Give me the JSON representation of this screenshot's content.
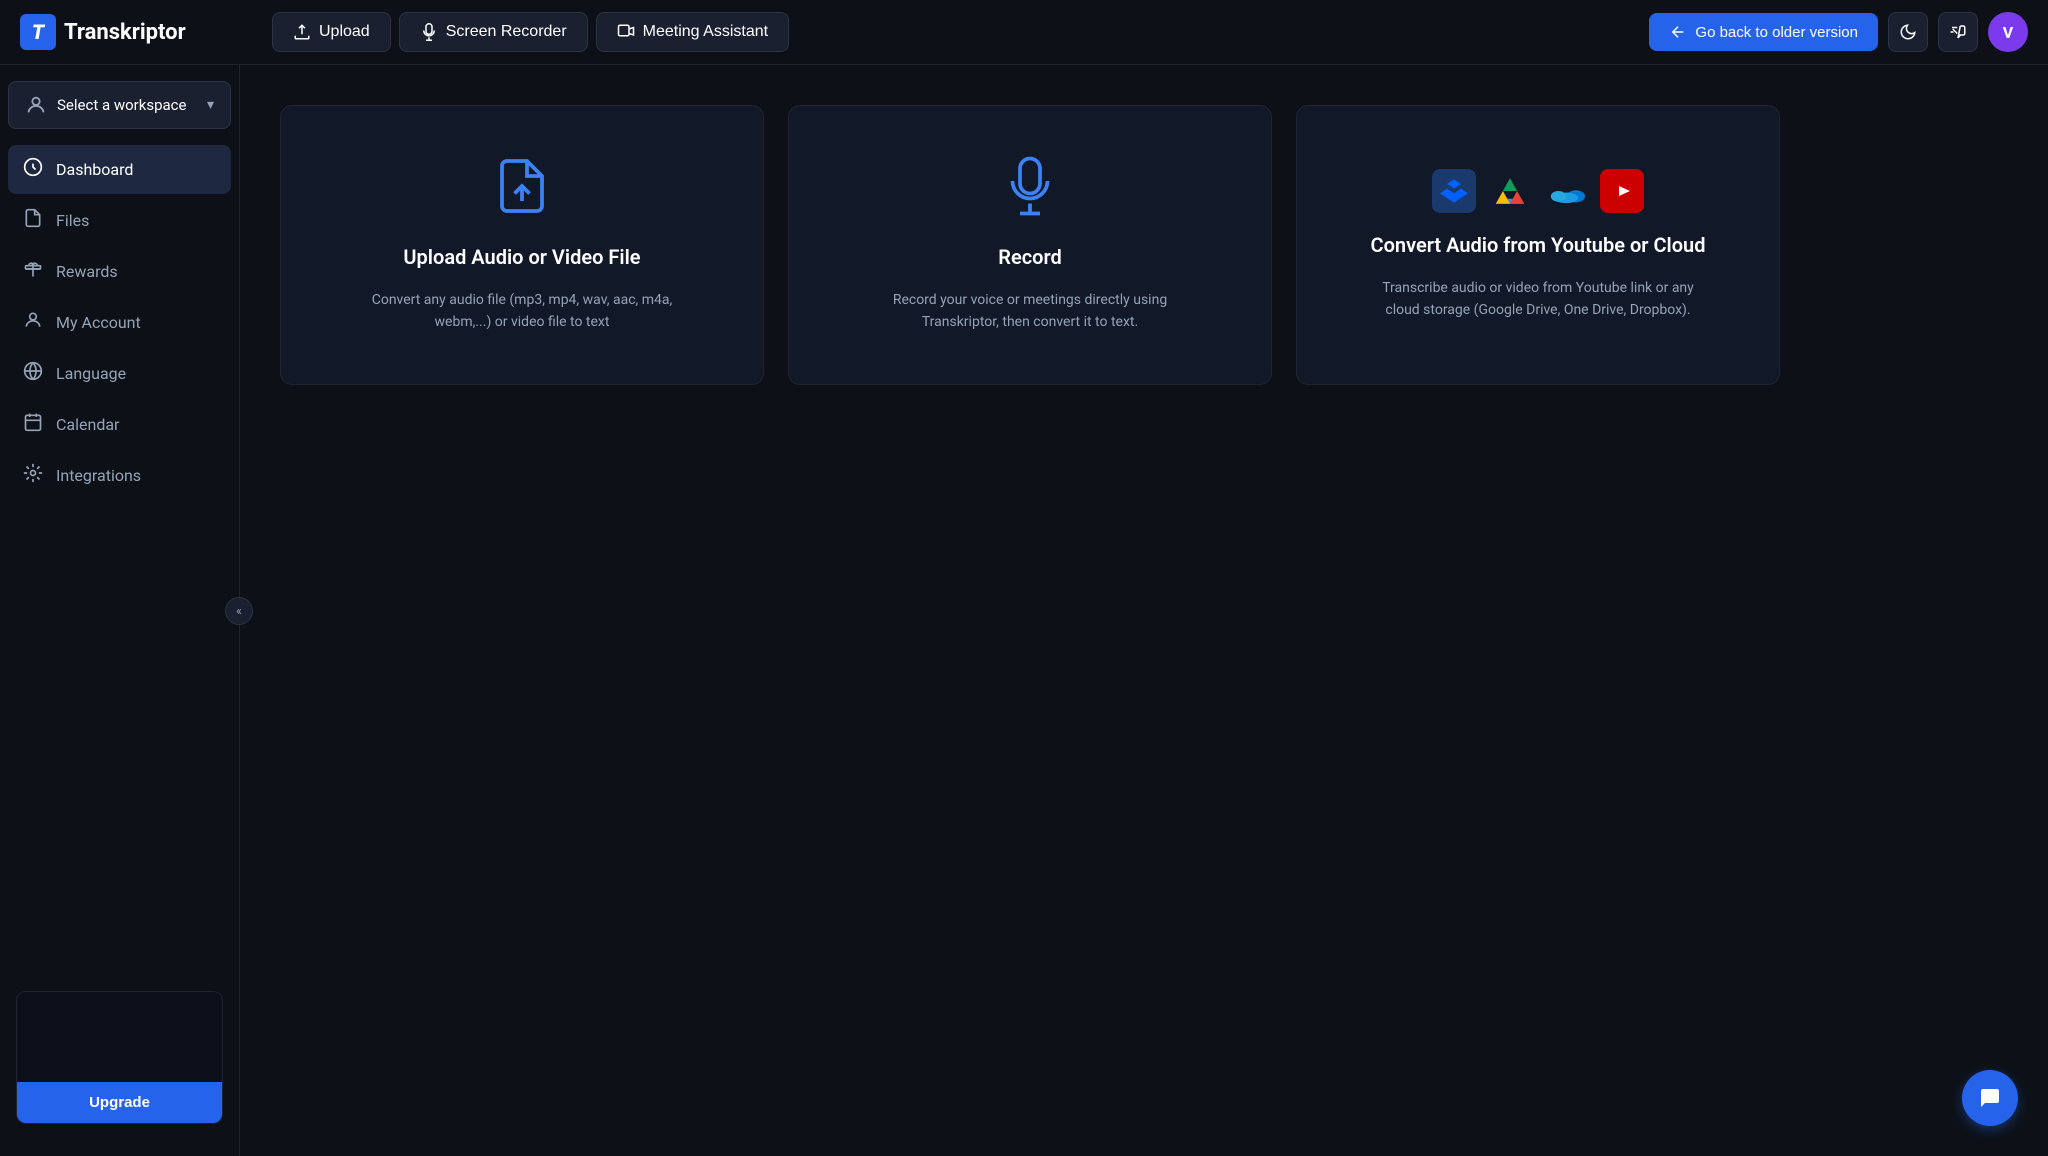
{
  "app": {
    "logo_letter": "T",
    "logo_name": "Transkriptor"
  },
  "header": {
    "upload_label": "Upload",
    "screen_recorder_label": "Screen Recorder",
    "meeting_assistant_label": "Meeting Assistant",
    "go_back_label": "Go back to older version",
    "avatar_letter": "V"
  },
  "sidebar": {
    "workspace_label": "Select a workspace",
    "items": [
      {
        "id": "dashboard",
        "label": "Dashboard",
        "active": true
      },
      {
        "id": "files",
        "label": "Files",
        "active": false
      },
      {
        "id": "rewards",
        "label": "Rewards",
        "active": false
      },
      {
        "id": "my-account",
        "label": "My Account",
        "active": false
      },
      {
        "id": "language",
        "label": "Language",
        "active": false
      },
      {
        "id": "calendar",
        "label": "Calendar",
        "active": false
      },
      {
        "id": "integrations",
        "label": "Integrations",
        "active": false
      }
    ],
    "upgrade_label": "Upgrade"
  },
  "cards": [
    {
      "id": "upload",
      "title": "Upload Audio or Video File",
      "description": "Convert any audio file (mp3, mp4, wav, aac, m4a, webm,...) or video file to text"
    },
    {
      "id": "record",
      "title": "Record",
      "description": "Record your voice or meetings directly using Transkriptor, then convert it to text."
    },
    {
      "id": "cloud",
      "title": "Convert Audio from Youtube or Cloud",
      "description": "Transcribe audio or video from Youtube link or any cloud storage (Google Drive, One Drive, Dropbox)."
    }
  ]
}
